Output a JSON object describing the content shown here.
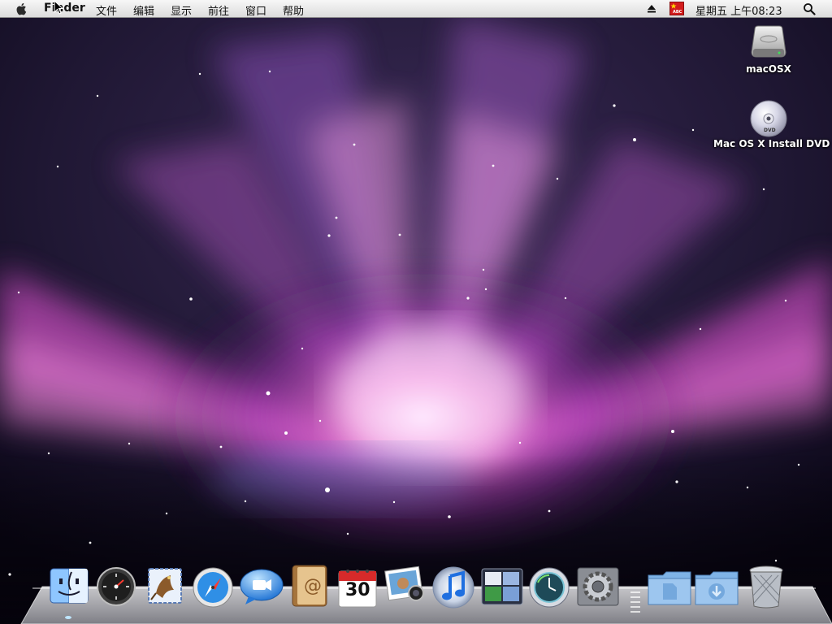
{
  "menubar": {
    "app_name": "Finder",
    "menus": [
      "文件",
      "编辑",
      "显示",
      "前往",
      "窗口",
      "帮助"
    ],
    "clock": "星期五 上午08:23",
    "input_badge": "ABC"
  },
  "desktop_icons": [
    {
      "label": "macOSX",
      "icon": "hard-drive-icon"
    },
    {
      "label": "Mac OS X Install DVD",
      "icon": "dvd-icon"
    }
  ],
  "dock": {
    "items": [
      {
        "name": "finder",
        "icon": "finder-icon"
      },
      {
        "name": "dashboard",
        "icon": "dashboard-icon"
      },
      {
        "name": "mail",
        "icon": "mail-icon"
      },
      {
        "name": "safari",
        "icon": "safari-icon"
      },
      {
        "name": "ichat",
        "icon": "ichat-icon"
      },
      {
        "name": "address-book",
        "icon": "address-book-icon"
      },
      {
        "name": "ical",
        "icon": "ical-icon",
        "date": "30"
      },
      {
        "name": "iphoto",
        "icon": "iphoto-icon"
      },
      {
        "name": "itunes",
        "icon": "itunes-icon"
      },
      {
        "name": "spaces",
        "icon": "spaces-icon"
      },
      {
        "name": "time-machine",
        "icon": "time-machine-icon"
      },
      {
        "name": "system-preferences",
        "icon": "system-preferences-icon"
      },
      {
        "name": "documents",
        "icon": "documents-folder-icon"
      },
      {
        "name": "downloads",
        "icon": "downloads-folder-icon"
      },
      {
        "name": "trash",
        "icon": "trash-icon"
      }
    ]
  }
}
